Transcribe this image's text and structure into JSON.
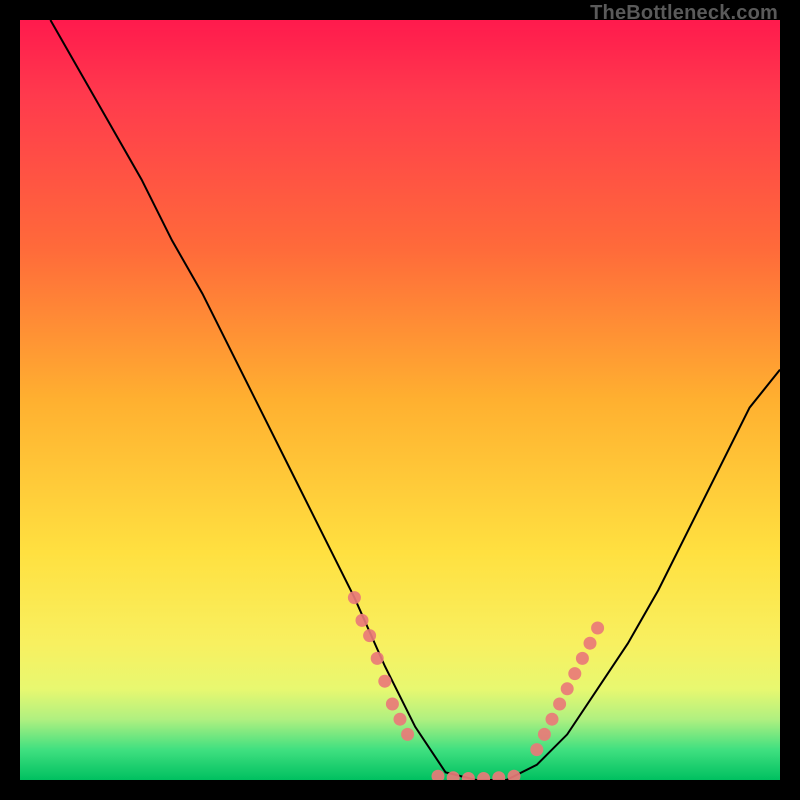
{
  "watermark": "TheBottleneck.com",
  "chart_data": {
    "type": "line",
    "title": "",
    "xlabel": "",
    "ylabel": "",
    "xlim": [
      0,
      100
    ],
    "ylim": [
      0,
      100
    ],
    "grid": false,
    "legend": false,
    "background": {
      "type": "vertical-gradient",
      "stops": [
        {
          "pct": 0,
          "color": "#ff1a4d"
        },
        {
          "pct": 10,
          "color": "#ff3a4d"
        },
        {
          "pct": 30,
          "color": "#ff6a3a"
        },
        {
          "pct": 50,
          "color": "#ffb030"
        },
        {
          "pct": 70,
          "color": "#ffe040"
        },
        {
          "pct": 82,
          "color": "#f8f060"
        },
        {
          "pct": 88,
          "color": "#e8f870"
        },
        {
          "pct": 92,
          "color": "#b0f080"
        },
        {
          "pct": 96,
          "color": "#40e080"
        },
        {
          "pct": 98,
          "color": "#20d070"
        },
        {
          "pct": 100,
          "color": "#00c060"
        }
      ]
    },
    "series": [
      {
        "name": "bottleneck-curve",
        "color": "#000000",
        "x": [
          4,
          8,
          12,
          16,
          20,
          24,
          28,
          32,
          36,
          40,
          44,
          48,
          52,
          56,
          60,
          64,
          68,
          72,
          76,
          80,
          84,
          88,
          92,
          96,
          100
        ],
        "values": [
          100,
          93,
          86,
          79,
          71,
          64,
          56,
          48,
          40,
          32,
          24,
          15,
          7,
          1,
          0,
          0,
          2,
          6,
          12,
          18,
          25,
          33,
          41,
          49,
          54
        ]
      }
    ],
    "markers": [
      {
        "name": "left-cluster",
        "color": "#e97a78",
        "points": [
          {
            "x": 44,
            "y": 24
          },
          {
            "x": 45,
            "y": 21
          },
          {
            "x": 46,
            "y": 19
          },
          {
            "x": 47,
            "y": 16
          },
          {
            "x": 48,
            "y": 13
          },
          {
            "x": 49,
            "y": 10
          },
          {
            "x": 50,
            "y": 8
          },
          {
            "x": 51,
            "y": 6
          }
        ]
      },
      {
        "name": "valley-cluster",
        "color": "#e97a78",
        "points": [
          {
            "x": 55,
            "y": 0.5
          },
          {
            "x": 57,
            "y": 0.3
          },
          {
            "x": 59,
            "y": 0.2
          },
          {
            "x": 61,
            "y": 0.2
          },
          {
            "x": 63,
            "y": 0.3
          },
          {
            "x": 65,
            "y": 0.5
          }
        ]
      },
      {
        "name": "right-cluster",
        "color": "#e97a78",
        "points": [
          {
            "x": 68,
            "y": 4
          },
          {
            "x": 69,
            "y": 6
          },
          {
            "x": 70,
            "y": 8
          },
          {
            "x": 71,
            "y": 10
          },
          {
            "x": 72,
            "y": 12
          },
          {
            "x": 73,
            "y": 14
          },
          {
            "x": 74,
            "y": 16
          },
          {
            "x": 75,
            "y": 18
          },
          {
            "x": 76,
            "y": 20
          }
        ]
      }
    ]
  }
}
